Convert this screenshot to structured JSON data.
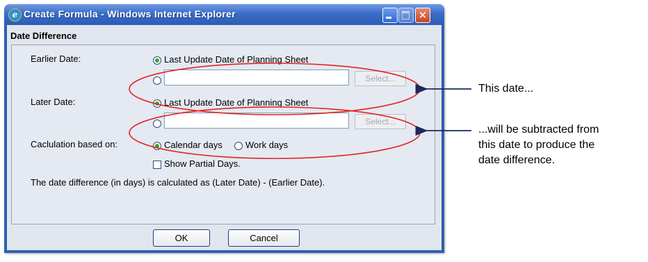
{
  "window": {
    "title": "Create Formula - Windows Internet Explorer",
    "close_glyph": "✕"
  },
  "section_title": "Date Difference",
  "earlier_date": {
    "label": "Earlier Date:",
    "option_label": "Last Update Date of Planning Sheet",
    "field_value": "",
    "select_label": "Select..."
  },
  "later_date": {
    "label": "Later Date:",
    "option_label": "Last Update Date of Planning Sheet",
    "field_value": "",
    "select_label": "Select..."
  },
  "calculation": {
    "label": "Caclulation based on:",
    "option_calendar": "Calendar days",
    "option_work": "Work days",
    "selected": "Calendar days"
  },
  "partial_days_label": "Show Partial Days.",
  "partial_days_checked": false,
  "formula_note": "The date difference (in days) is calculated as (Later Date) - (Earlier Date).",
  "buttons": {
    "ok": "OK",
    "cancel": "Cancel"
  },
  "annotations": {
    "line1": "This date...",
    "line2": "...will be subtracted from",
    "line3": "this date to produce the",
    "line4": "date difference.",
    "ellipse_color": "#e02424"
  }
}
